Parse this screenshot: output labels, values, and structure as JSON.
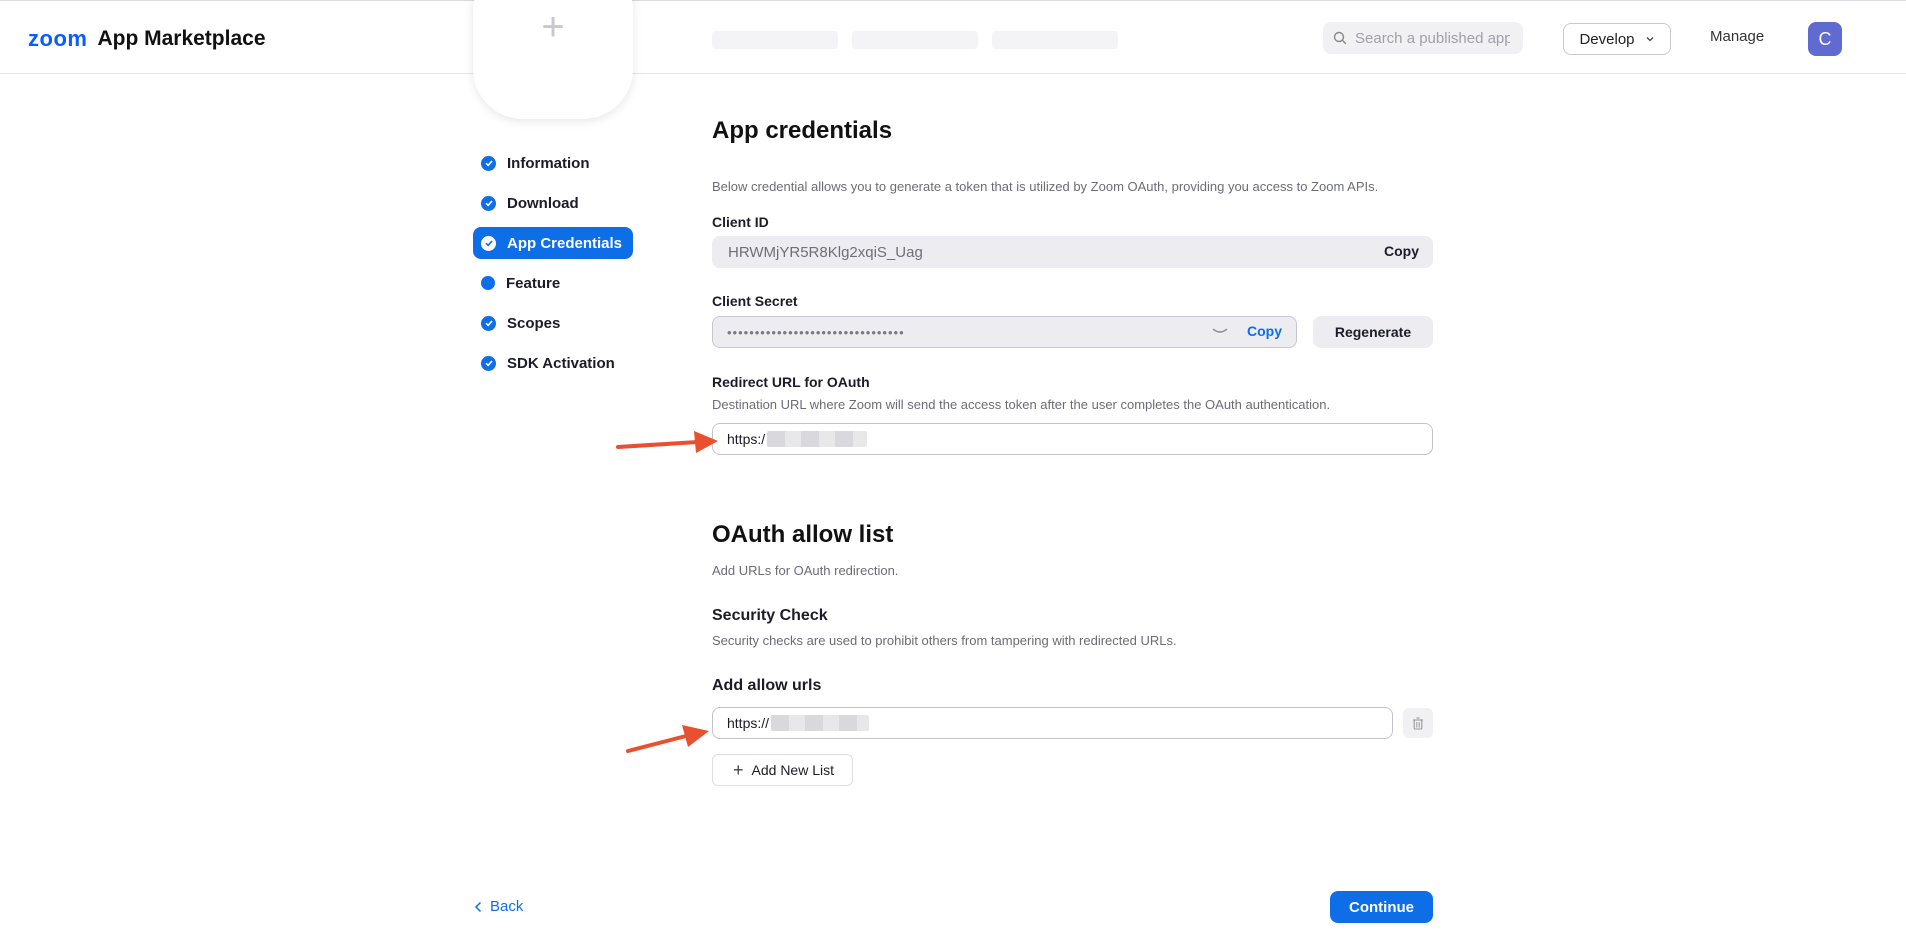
{
  "header": {
    "logo_zoom": "zoom",
    "logo_app": "App Marketplace",
    "search_placeholder": "Search a published app",
    "develop_label": "Develop",
    "manage_label": "Manage",
    "avatar_initial": "C"
  },
  "sidebar": {
    "items": [
      {
        "label": "Information",
        "status": "done"
      },
      {
        "label": "Download",
        "status": "done"
      },
      {
        "label": "App Credentials",
        "status": "active"
      },
      {
        "label": "Feature",
        "status": "pending"
      },
      {
        "label": "Scopes",
        "status": "done"
      },
      {
        "label": "SDK Activation",
        "status": "done"
      }
    ]
  },
  "credentials": {
    "title": "App credentials",
    "description": "Below credential allows you to generate a token that is utilized by Zoom OAuth, providing you access to Zoom APIs.",
    "client_id_label": "Client ID",
    "client_id_value": "HRWMjYR5R8Klg2xqiS_Uag",
    "copy_label": "Copy",
    "client_secret_label": "Client Secret",
    "client_secret_masked": "••••••••••••••••••••••••••••••••",
    "copy_secret_label": "Copy",
    "regenerate_label": "Regenerate",
    "redirect_label": "Redirect URL for OAuth",
    "redirect_description": "Destination URL where Zoom will send the access token after the user completes the OAuth authentication.",
    "redirect_value": "https:/"
  },
  "allow_list": {
    "title": "OAuth allow list",
    "description": "Add URLs for OAuth redirection.",
    "security_title": "Security Check",
    "security_description": "Security checks are used to prohibit others from tampering with redirected URLs.",
    "add_urls_label": "Add allow urls",
    "url_value": "https://",
    "add_new_list_label": "Add New List"
  },
  "footer": {
    "back_label": "Back",
    "continue_label": "Continue"
  },
  "colors": {
    "accent": "#0e6ee8",
    "annotation_arrow": "#e8502f"
  }
}
